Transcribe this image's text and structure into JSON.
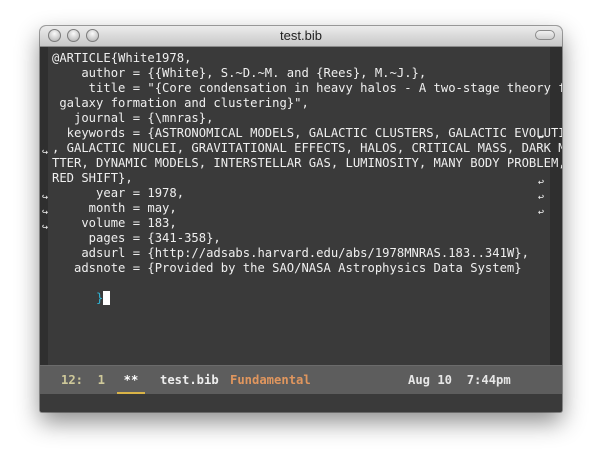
{
  "window": {
    "title": "test.bib"
  },
  "editor": {
    "lines": [
      "@ARTICLE{White1978,",
      "    author = {{White}, S.~D.~M. and {Rees}, M.~J.},",
      "     title = \"{Core condensation in heavy halos - A two-stage theory for",
      " galaxy formation and clustering}\",",
      "   journal = {\\mnras},",
      "  keywords = {ASTRONOMICAL MODELS, GALACTIC CLUSTERS, GALACTIC EVOLUTION",
      ", GALACTIC NUCLEI, GRAVITATIONAL EFFECTS, HALOS, CRITICAL MASS, DARK MA",
      "TTER, DYNAMIC MODELS, INTERSTELLAR GAS, LUMINOSITY, MANY BODY PROBLEM, ",
      "RED SHIFT},",
      "      year = 1978,",
      "     month = may,",
      "    volume = 183,",
      "     pages = {341-358},",
      "    adsurl = {http://adsabs.harvard.edu/abs/1978MNRAS.183..341W},",
      "   adsnote = {Provided by the SAO/NASA Astrophysics Data System}"
    ],
    "last_line": "}"
  },
  "modeline": {
    "position": "12:  1",
    "modified": "**",
    "buffer_name": "test.bib",
    "major_mode": "Fundamental",
    "time": "Aug 10  7:44pm"
  },
  "colors": {
    "background": "#3a3a3a",
    "text": "#efefef",
    "bracket": "#2fb5d6",
    "mode": "#e0965e",
    "modeline": "#5d5d5d"
  }
}
